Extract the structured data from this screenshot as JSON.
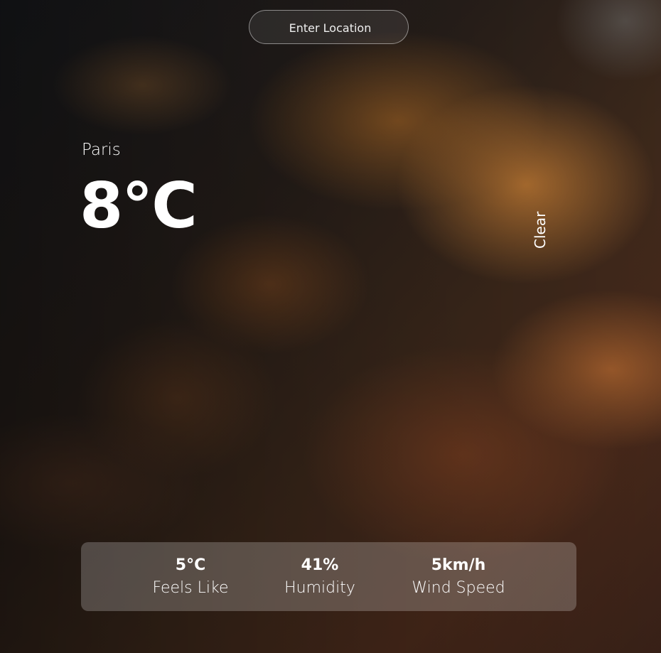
{
  "search": {
    "placeholder": "Enter Location"
  },
  "weather": {
    "city": "Paris",
    "temperature": "8°C",
    "description": "Clear"
  },
  "stats": {
    "feels_like": {
      "value": "5°C",
      "label": "Feels Like"
    },
    "humidity": {
      "value": "41%",
      "label": "Humidity"
    },
    "wind_speed": {
      "value": "5km/h",
      "label": "Wind Speed"
    }
  }
}
